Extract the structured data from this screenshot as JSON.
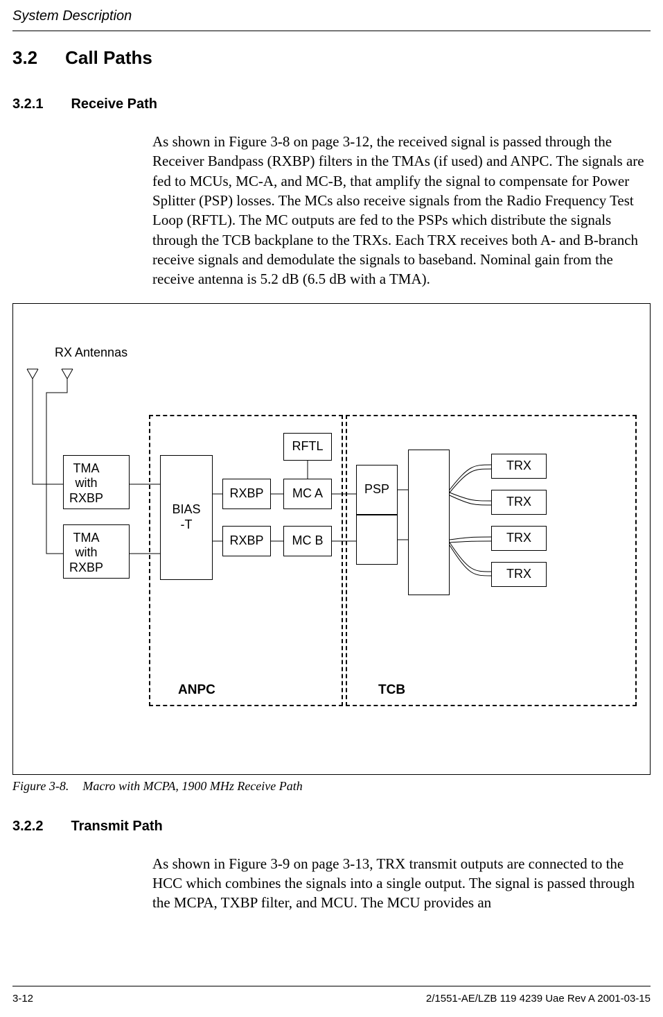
{
  "running_header": "System Description",
  "section": {
    "number": "3.2",
    "title": "Call Paths"
  },
  "subsection_1": {
    "number": "3.2.1",
    "title": "Receive Path",
    "paragraph": "As shown in Figure 3-8 on page 3-12, the received signal is passed through the Receiver Bandpass (RXBP) filters in the TMAs (if used) and ANPC. The signals are fed to MCUs, MC-A, and MC-B, that amplify the signal to compensate for Power Splitter (PSP) losses. The MCs also receive signals from the Radio Frequency Test Loop (RFTL). The MC outputs are fed to the PSPs which distribute the signals through the TCB backplane to the TRXs. Each TRX receives both A- and B-branch receive signals and demodulate the signals to baseband. Nominal gain from the receive antenna is 5.2 dB (6.5 dB with a TMA)."
  },
  "figure": {
    "number": "Figure 3-8.",
    "title": "Macro with MCPA, 1900 MHz Receive Path",
    "labels": {
      "rx_antennas": "RX Antennas",
      "tma_rxbp": "TMA\nwith\nRXBP",
      "bias_t": "BIAS\n-T",
      "rxbp": "RXBP",
      "mc_a": "MC A",
      "mc_b": "MC B",
      "rftl": "RFTL",
      "psp": "PSP",
      "trx": "TRX",
      "anpc": "ANPC",
      "tcb": "TCB"
    }
  },
  "subsection_2": {
    "number": "3.2.2",
    "title": "Transmit Path",
    "paragraph": "As shown in Figure 3-9 on page 3-13, TRX transmit outputs are connected to the HCC which combines the signals into a single output. The signal is passed through the MCPA, TXBP filter, and MCU. The MCU provides an"
  },
  "footer": {
    "page": "3-12",
    "docid": "2/1551-AE/LZB 119 4239 Uae Rev A 2001-03-15"
  }
}
